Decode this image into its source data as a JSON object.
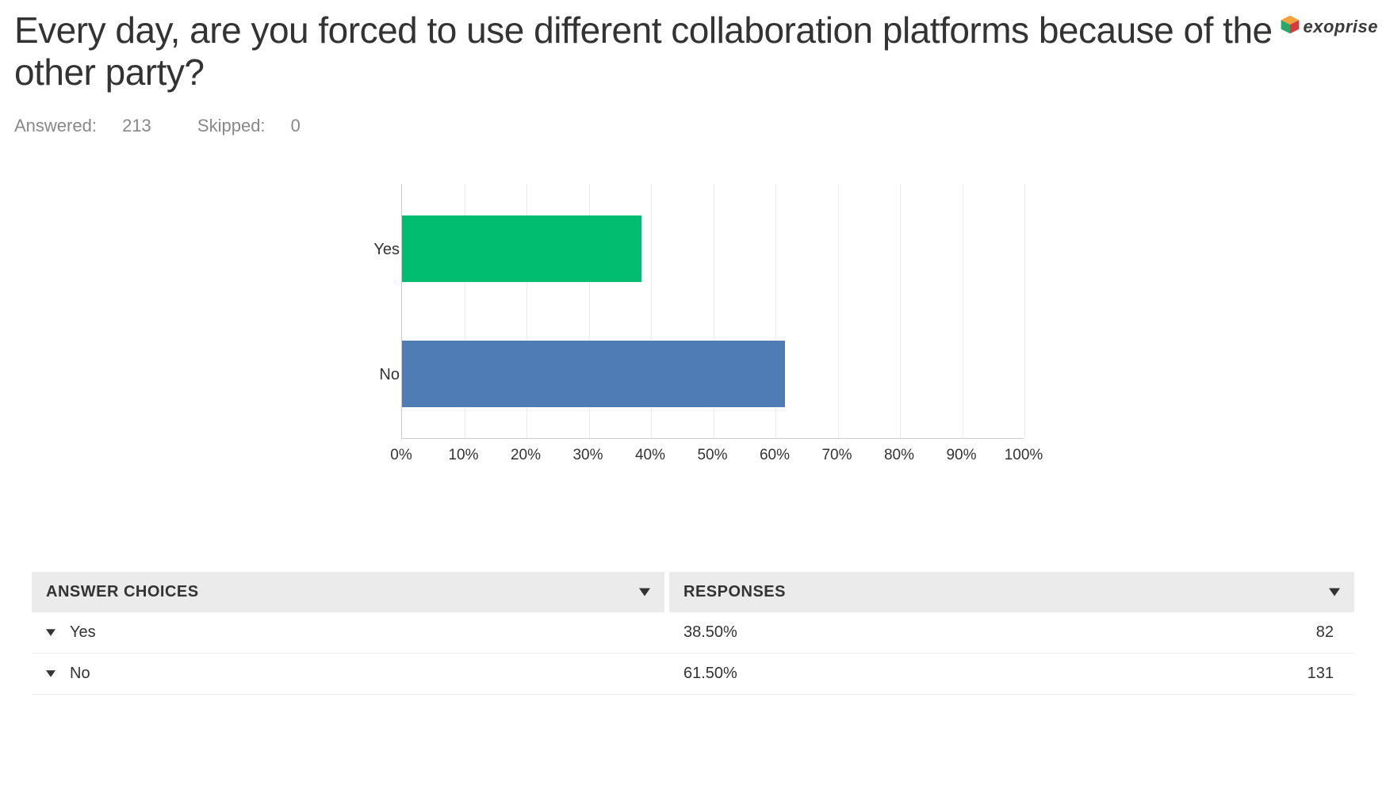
{
  "logo_text": "exoprise",
  "title": "Every day, are you forced to use different collaboration platforms because of the other party?",
  "meta": {
    "answered_label": "Answered:",
    "answered_value": "213",
    "skipped_label": "Skipped:",
    "skipped_value": "0"
  },
  "chart_data": {
    "type": "bar",
    "orientation": "horizontal",
    "categories": [
      "Yes",
      "No"
    ],
    "values": [
      38.5,
      61.5
    ],
    "xlabel": "",
    "ylabel": "",
    "xlim": [
      0,
      100
    ],
    "x_tick_labels": [
      "0%",
      "10%",
      "20%",
      "30%",
      "40%",
      "50%",
      "60%",
      "70%",
      "80%",
      "90%",
      "100%"
    ],
    "colors": [
      "#00bd6f",
      "#507cb5"
    ]
  },
  "table": {
    "col_answer": "ANSWER CHOICES",
    "col_responses": "RESPONSES",
    "rows": [
      {
        "label": "Yes",
        "pct": "38.50%",
        "count": "82"
      },
      {
        "label": "No",
        "pct": "61.50%",
        "count": "131"
      }
    ]
  }
}
